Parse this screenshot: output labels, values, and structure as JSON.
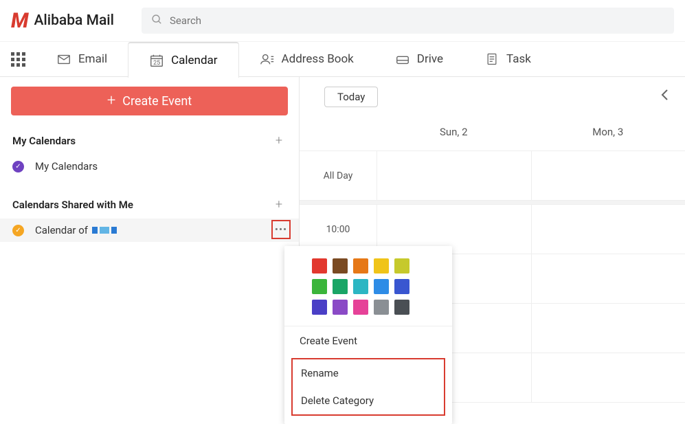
{
  "app_name": "Alibaba Mail",
  "search": {
    "placeholder": "Search"
  },
  "tabs": {
    "email": "Email",
    "calendar": "Calendar",
    "address_book": "Address Book",
    "drive": "Drive",
    "task": "Task"
  },
  "calendar_tab_day_number": "25",
  "create_event_button": "Create Event",
  "sections": {
    "my_calendars_header": "My Calendars",
    "my_calendars_item": "My Calendars",
    "shared_header": "Calendars Shared with Me",
    "shared_item_prefix": "Calendar of "
  },
  "toolbar": {
    "today": "Today"
  },
  "day_headers": {
    "sun": "Sun, 2",
    "mon": "Mon, 3"
  },
  "time_rows": {
    "all_day": "All Day",
    "t1000": "10:00"
  },
  "popover": {
    "colors": [
      "#e2382e",
      "#7a4a22",
      "#e67817",
      "#f0c419",
      "#c6c92c",
      "#3bb53b",
      "#1aa566",
      "#2cb6c3",
      "#2e8ce6",
      "#3956d0",
      "#4a3fc6",
      "#8a4ac6",
      "#e64298",
      "#8a8f94",
      "#4a4f54"
    ],
    "create_event": "Create Event",
    "rename": "Rename",
    "delete_category": "Delete Category"
  }
}
